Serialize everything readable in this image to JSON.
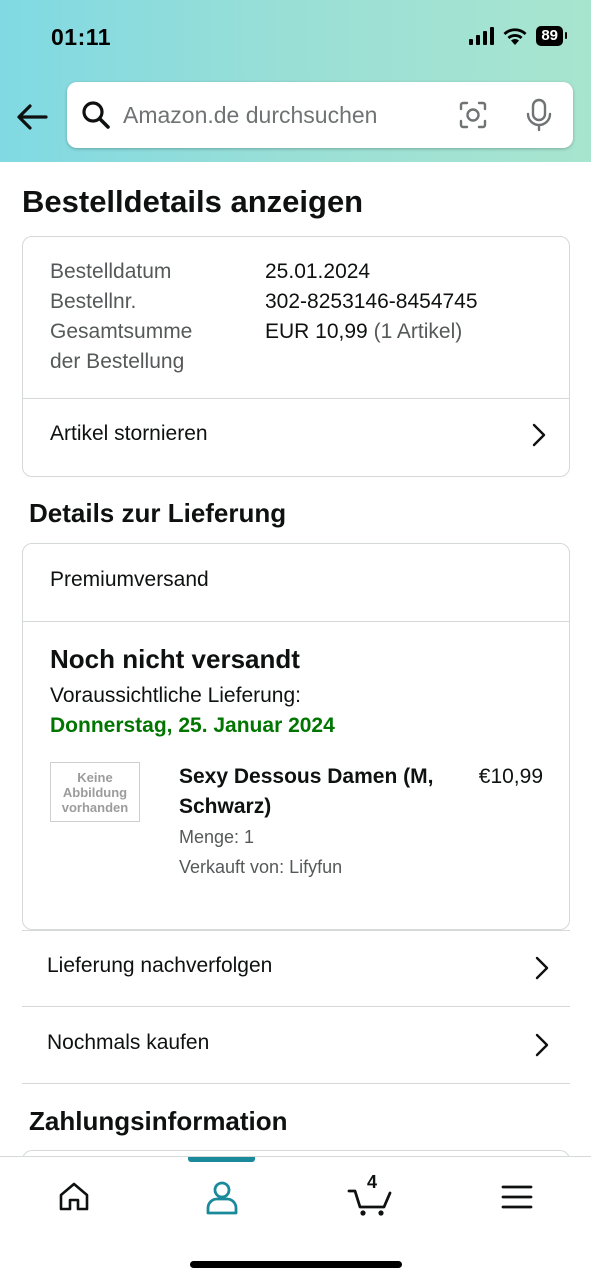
{
  "status_bar": {
    "time": "01:11",
    "battery": "89"
  },
  "search": {
    "placeholder": "Amazon.de durchsuchen"
  },
  "page": {
    "title": "Bestelldetails anzeigen"
  },
  "order_summary": {
    "date_label": "Bestelldatum",
    "date_value": "25.01.2024",
    "number_label": "Bestellnr.",
    "number_value": "302-8253146-8454745",
    "total_label_line1": "Gesamtsumme",
    "total_label_line2": "der Bestellung",
    "total_value": "EUR 10,99",
    "total_items": "(1 Artikel)",
    "cancel_label": "Artikel stornieren"
  },
  "delivery": {
    "section_title": "Details zur Lieferung",
    "shipping_method": "Premiumversand",
    "status": "Noch nicht versandt",
    "eta_label": "Voraussichtliche Lieferung:",
    "eta_date": "Donnerstag, 25. Januar 2024",
    "item": {
      "image_placeholder": "Keine Abbildung vorhanden",
      "title": "Sexy Dessous Damen (M, Schwarz)",
      "price": "€10,99",
      "quantity": "Menge: 1",
      "seller": "Verkauft von: Lifyfun"
    },
    "colors": {
      "eta": "#007600"
    }
  },
  "actions": {
    "track": "Lieferung nachverfolgen",
    "buy_again": "Nochmals kaufen"
  },
  "payment": {
    "section_title": "Zahlungsinformation"
  },
  "bottom_nav": {
    "items": [
      {
        "icon": "home-icon"
      },
      {
        "icon": "account-icon",
        "active": true
      },
      {
        "icon": "cart-icon",
        "count": "4"
      },
      {
        "icon": "menu-icon"
      }
    ],
    "accent": "#1a8a9b"
  }
}
